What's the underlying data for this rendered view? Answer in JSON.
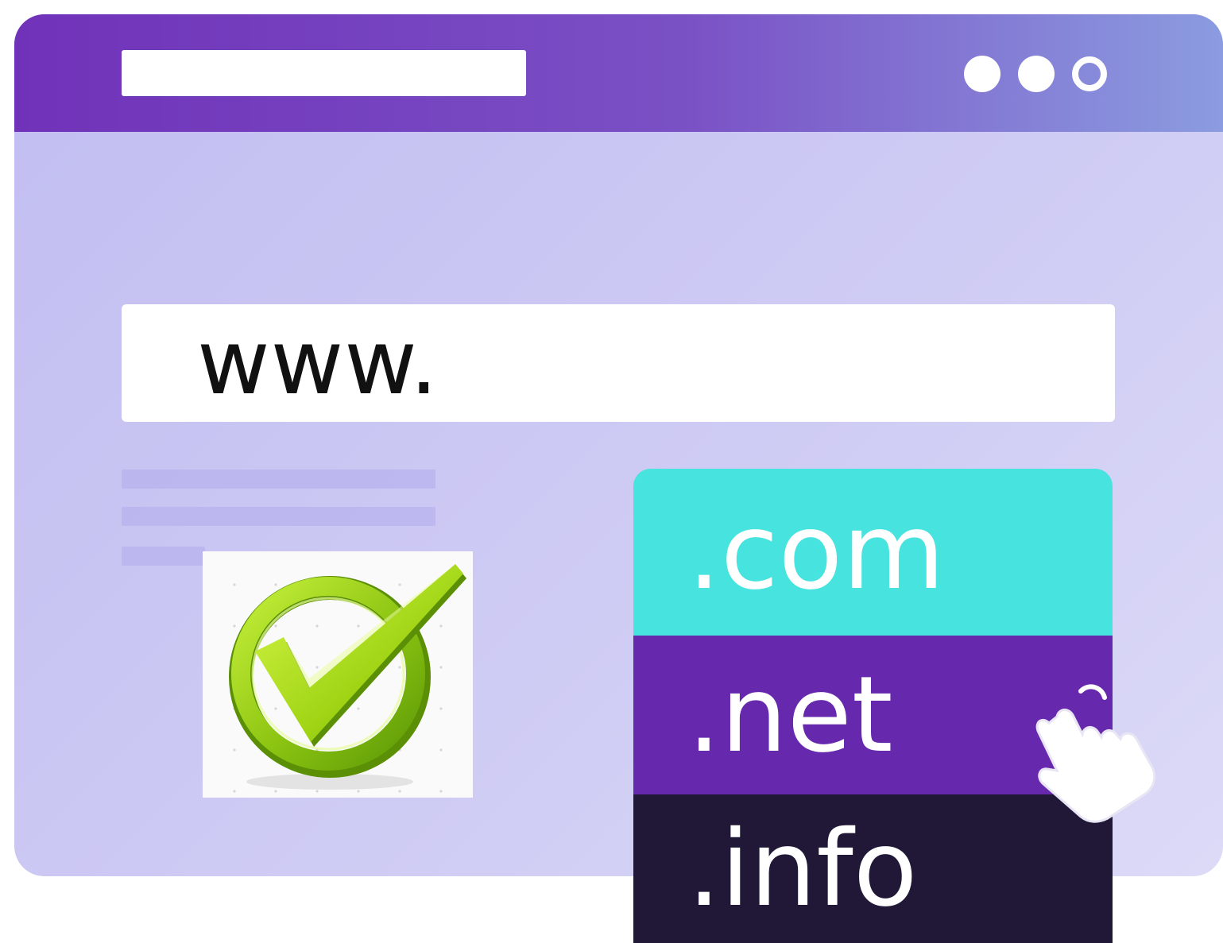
{
  "browser": {
    "address_text": "www.",
    "titlebar_color_start": "#7032b9",
    "titlebar_color_end": "#8b9ce0",
    "window_icons": [
      "dot-icon",
      "dot-icon",
      "refresh-ring-icon"
    ]
  },
  "verification": {
    "icon": "checkmark-circle-icon",
    "color": "#9ed70c"
  },
  "domains": [
    {
      "label": ".com",
      "color": "#47e3de"
    },
    {
      "label": ".net",
      "color": "#6628ac"
    },
    {
      "label": ".info",
      "color": "#211838"
    }
  ],
  "pointer": {
    "icon": "hand-cursor-icon"
  }
}
